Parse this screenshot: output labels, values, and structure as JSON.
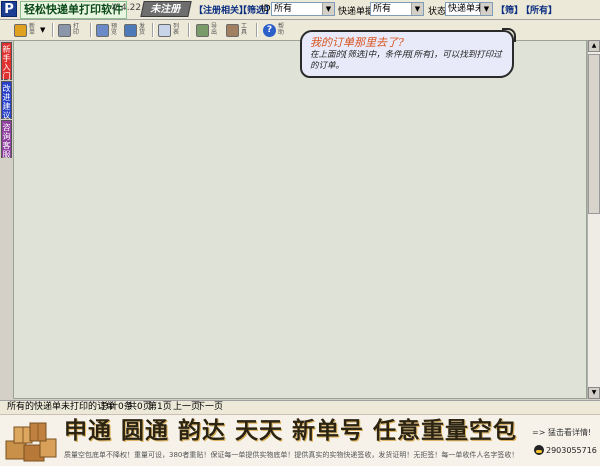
{
  "app": {
    "logo_letter": "P",
    "name": "轻松快递单打印软件",
    "version": "V 4.22",
    "register_label": "未注册"
  },
  "filters": {
    "register_link": "【注册相关】",
    "filter_link": "【筛选】",
    "id_label": "ID:",
    "id_value": "所有",
    "courier_label": "快递单据:",
    "courier_value": "所有",
    "state_label": "状态:",
    "state_value": "快递单未打",
    "filter_btn": "【筛】",
    "all_btn": "【所有】"
  },
  "toolbar": {
    "items": [
      {
        "icon": "edit-icon",
        "label": "新单",
        "color": "#e0a020"
      },
      {
        "icon": "print-icon",
        "label": "打印",
        "color": "#8c96aa"
      },
      {
        "icon": "preview-icon",
        "label": "预览",
        "color": "#6b8bc8"
      },
      {
        "icon": "send-icon",
        "label": "发货",
        "color": "#4e7ab8"
      },
      {
        "icon": "list-icon",
        "label": "列表",
        "color": "#c8d4e8"
      },
      {
        "icon": "export-icon",
        "label": "导出",
        "color": "#7a9a6a"
      },
      {
        "icon": "tools-icon",
        "label": "工具",
        "color": "#a08060"
      },
      {
        "icon": "help-icon",
        "label": "帮助",
        "color": "#2d5fc9"
      }
    ]
  },
  "sidetabs": [
    {
      "label": "新手入门",
      "color": "#e03030"
    },
    {
      "label": "改进建议",
      "color": "#2840c8"
    },
    {
      "label": "咨询客服",
      "color": "#9040a0"
    }
  ],
  "note": {
    "title": "我的订单那里去了?",
    "body": "在上面的[筛选]中，条件用[所有]，可以找到打印过的订单。"
  },
  "status": {
    "scope": "所有的快递单未打印的订单",
    "total": "总计0条",
    "pages": "共0页",
    "current_page": "第1页",
    "prev": "上一页",
    "next": "下一页"
  },
  "banner": {
    "headline": "申通 圆通 韵达 天天 新单号 任意重量空包",
    "subline": "质量空包底单不降权！重量可设，380者重贴！保证每一单提供实物底单！提供真实的实物快递签收，发货证明！无拒签！每一单收件人名字签收！",
    "more": "=> 猛击看详情!",
    "qq": "2903055716"
  }
}
